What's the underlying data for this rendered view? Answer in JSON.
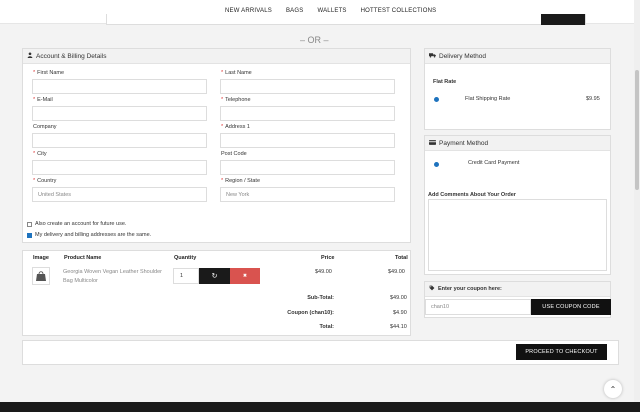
{
  "nav": {
    "items": [
      "NEW ARRIVALS",
      "BAGS",
      "WALLETS",
      "HOTTEST COLLECTIONS"
    ]
  },
  "divider": "– OR –",
  "billing": {
    "title": "Account & Billing Details",
    "first_name": "First Name",
    "last_name": "Last Name",
    "email": "E-Mail",
    "telephone": "Telephone",
    "company": "Company",
    "address1": "Address 1",
    "city": "City",
    "postcode": "Post Code",
    "country": "Country",
    "country_value": "United States",
    "region": "Region / State",
    "region_value": "New York",
    "create_account": "Also create an account for future use.",
    "same_address": "My delivery and billing addresses are the same."
  },
  "cart": {
    "headers": {
      "image": "Image",
      "product": "Product Name",
      "quantity": "Quantity",
      "price": "Price",
      "total": "Total"
    },
    "rows": [
      {
        "name": "Georgia Woven Vegan Leather Shoulder Bag Multicolor",
        "quantity": "1",
        "price": "$49.00",
        "total": "$49.00"
      }
    ],
    "subtotal_label": "Sub-Total:",
    "subtotal": "$49.00",
    "coupon_label": "Coupon (chan10):",
    "coupon": "$4.90",
    "total_label": "Total:",
    "total": "$44.10"
  },
  "delivery": {
    "title": "Delivery Method",
    "group": "Flat Rate",
    "option": "Flat Shipping Rate",
    "price": "$9.95"
  },
  "payment": {
    "title": "Payment Method",
    "option": "Credit Card Payment",
    "comments_label": "Add Comments About Your Order"
  },
  "coupon": {
    "title": "Enter your coupon here:",
    "value": "chan10",
    "button": "USE COUPON CODE"
  },
  "checkout": {
    "button": "PROCEED TO CHECKOUT"
  },
  "icons": {
    "refresh": "↻",
    "remove": "✖",
    "up": "⌃"
  },
  "colors": {
    "accent": "#1e73be",
    "danger": "#d9534f",
    "dark": "#111111"
  }
}
